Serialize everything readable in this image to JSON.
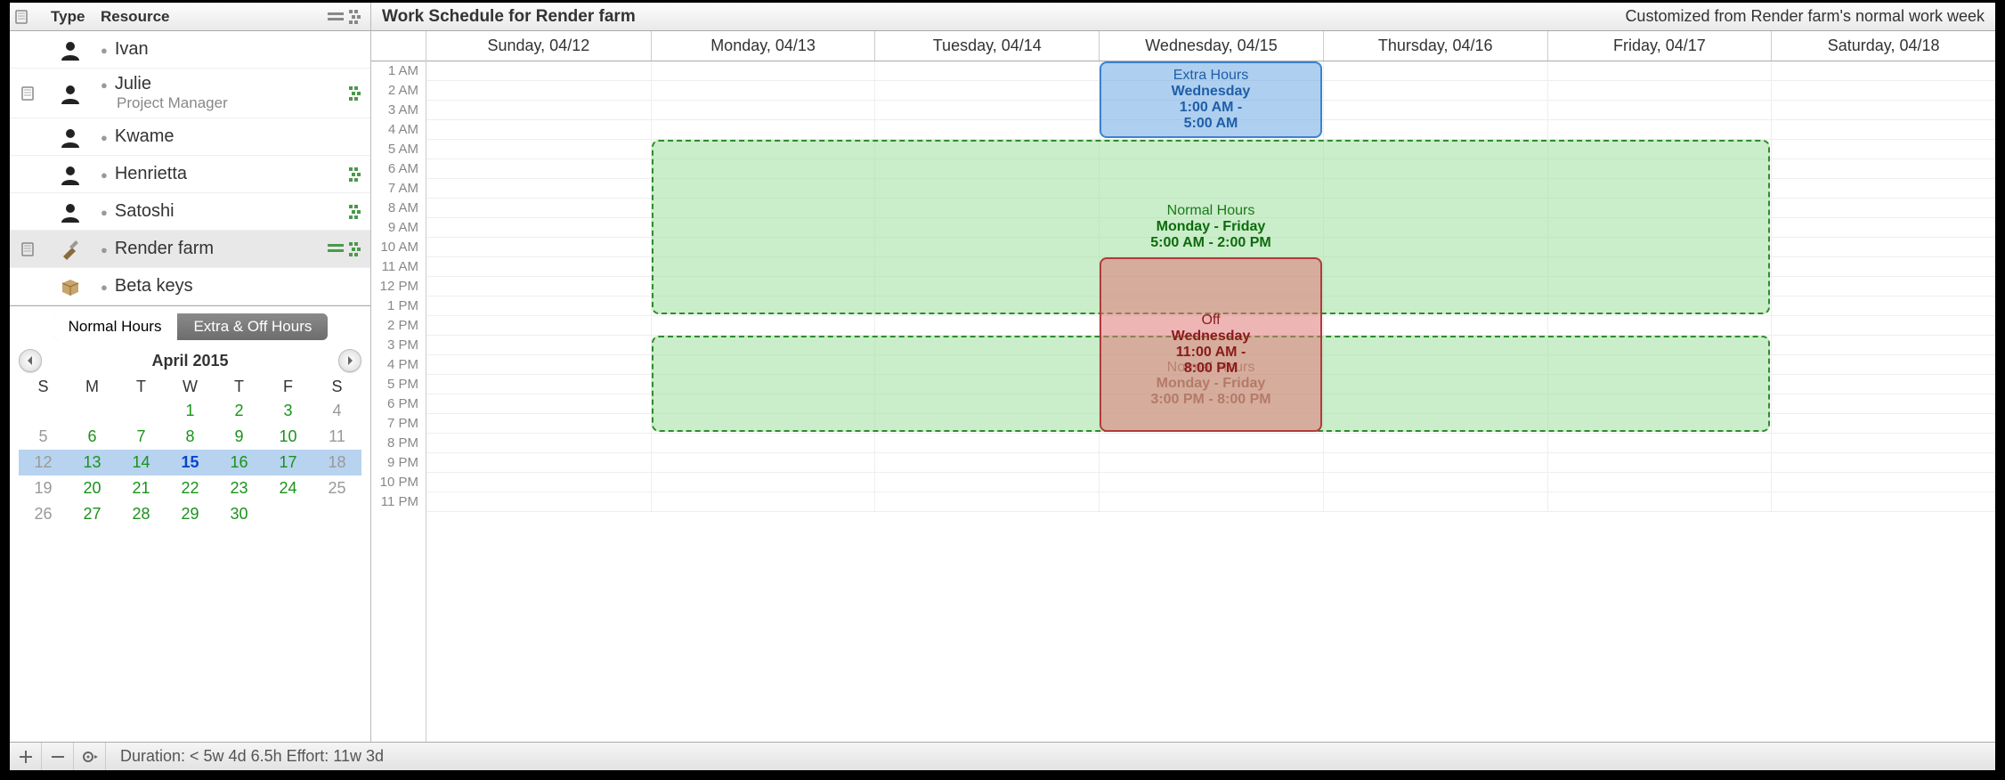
{
  "sidebar": {
    "header": {
      "col_type": "Type",
      "col_resource": "Resource"
    },
    "resources": [
      {
        "name": "Ivan",
        "role": "",
        "type": "person",
        "note": false,
        "bars": false,
        "cluster": false
      },
      {
        "name": "Julie",
        "role": "Project Manager",
        "type": "person",
        "note": true,
        "bars": false,
        "cluster": true
      },
      {
        "name": "Kwame",
        "role": "",
        "type": "person",
        "note": false,
        "bars": false,
        "cluster": false
      },
      {
        "name": "Henrietta",
        "role": "",
        "type": "person",
        "note": false,
        "bars": false,
        "cluster": true
      },
      {
        "name": "Satoshi",
        "role": "",
        "type": "person",
        "note": false,
        "bars": false,
        "cluster": true
      },
      {
        "name": "Render farm",
        "role": "",
        "type": "tool",
        "note": true,
        "bars": true,
        "cluster": true
      },
      {
        "name": "Beta keys",
        "role": "",
        "type": "package",
        "note": false,
        "bars": false,
        "cluster": false
      }
    ],
    "selected_index": 5,
    "segmented": {
      "left": "Normal Hours",
      "right": "Extra & Off Hours",
      "active": "right"
    },
    "calendar": {
      "title": "April 2015",
      "dow": [
        "S",
        "M",
        "T",
        "W",
        "T",
        "F",
        "S"
      ],
      "weeks": [
        [
          {
            "d": "",
            "c": "empty"
          },
          {
            "d": "",
            "c": "empty"
          },
          {
            "d": "",
            "c": "empty"
          },
          {
            "d": "1",
            "c": ""
          },
          {
            "d": "2",
            "c": ""
          },
          {
            "d": "3",
            "c": ""
          },
          {
            "d": "4",
            "c": "muted"
          }
        ],
        [
          {
            "d": "5",
            "c": "muted"
          },
          {
            "d": "6",
            "c": ""
          },
          {
            "d": "7",
            "c": ""
          },
          {
            "d": "8",
            "c": ""
          },
          {
            "d": "9",
            "c": ""
          },
          {
            "d": "10",
            "c": ""
          },
          {
            "d": "11",
            "c": "muted"
          }
        ],
        [
          {
            "d": "12",
            "c": "muted"
          },
          {
            "d": "13",
            "c": ""
          },
          {
            "d": "14",
            "c": ""
          },
          {
            "d": "15",
            "c": "focus"
          },
          {
            "d": "16",
            "c": ""
          },
          {
            "d": "17",
            "c": ""
          },
          {
            "d": "18",
            "c": "muted"
          }
        ],
        [
          {
            "d": "19",
            "c": "muted"
          },
          {
            "d": "20",
            "c": ""
          },
          {
            "d": "21",
            "c": ""
          },
          {
            "d": "22",
            "c": ""
          },
          {
            "d": "23",
            "c": ""
          },
          {
            "d": "24",
            "c": ""
          },
          {
            "d": "25",
            "c": "muted"
          }
        ],
        [
          {
            "d": "26",
            "c": "muted"
          },
          {
            "d": "27",
            "c": ""
          },
          {
            "d": "28",
            "c": ""
          },
          {
            "d": "29",
            "c": ""
          },
          {
            "d": "30",
            "c": ""
          },
          {
            "d": "",
            "c": "empty"
          },
          {
            "d": "",
            "c": "empty"
          }
        ]
      ],
      "selected_week": 2
    }
  },
  "right": {
    "title": "Work Schedule for Render farm",
    "note": "Customized from Render farm's normal work week",
    "days": [
      "Sunday, 04/12",
      "Monday, 04/13",
      "Tuesday, 04/14",
      "Wednesday, 04/15",
      "Thursday, 04/16",
      "Friday, 04/17",
      "Saturday, 04/18"
    ],
    "hour_labels": [
      "1 AM",
      "2 AM",
      "3 AM",
      "4 AM",
      "5 AM",
      "6 AM",
      "7 AM",
      "8 AM",
      "9 AM",
      "10 AM",
      "11 AM",
      "12 PM",
      "1 PM",
      "2 PM",
      "3 PM",
      "4 PM",
      "5 PM",
      "6 PM",
      "7 PM",
      "8 PM",
      "9 PM",
      "10 PM",
      "11 PM"
    ],
    "events": [
      {
        "kind": "blue",
        "day_start": 3,
        "day_span": 1,
        "hour_start": 1,
        "hour_span": 4,
        "line1": "Extra Hours",
        "line2": "Wednesday",
        "line3": "1:00 AM -",
        "line4": "5:00 AM"
      },
      {
        "kind": "green",
        "day_start": 1,
        "day_span": 5,
        "hour_start": 5,
        "hour_span": 9,
        "line1": "Normal Hours",
        "line2": "Monday - Friday",
        "line3": "5:00 AM - 2:00 PM",
        "line4": ""
      },
      {
        "kind": "green2",
        "day_start": 1,
        "day_span": 5,
        "hour_start": 15,
        "hour_span": 5,
        "line1": "Normal Hours",
        "line2": "Monday - Friday",
        "line3": "3:00 PM - 8:00 PM",
        "line4": ""
      },
      {
        "kind": "red",
        "day_start": 3,
        "day_span": 1,
        "hour_start": 11,
        "hour_span": 9,
        "line1": "Off",
        "line2": "Wednesday",
        "line3": "11:00 AM -",
        "line4": "8:00 PM"
      }
    ]
  },
  "footer": {
    "status": "Duration: < 5w 4d 6.5h Effort: 11w 3d"
  }
}
